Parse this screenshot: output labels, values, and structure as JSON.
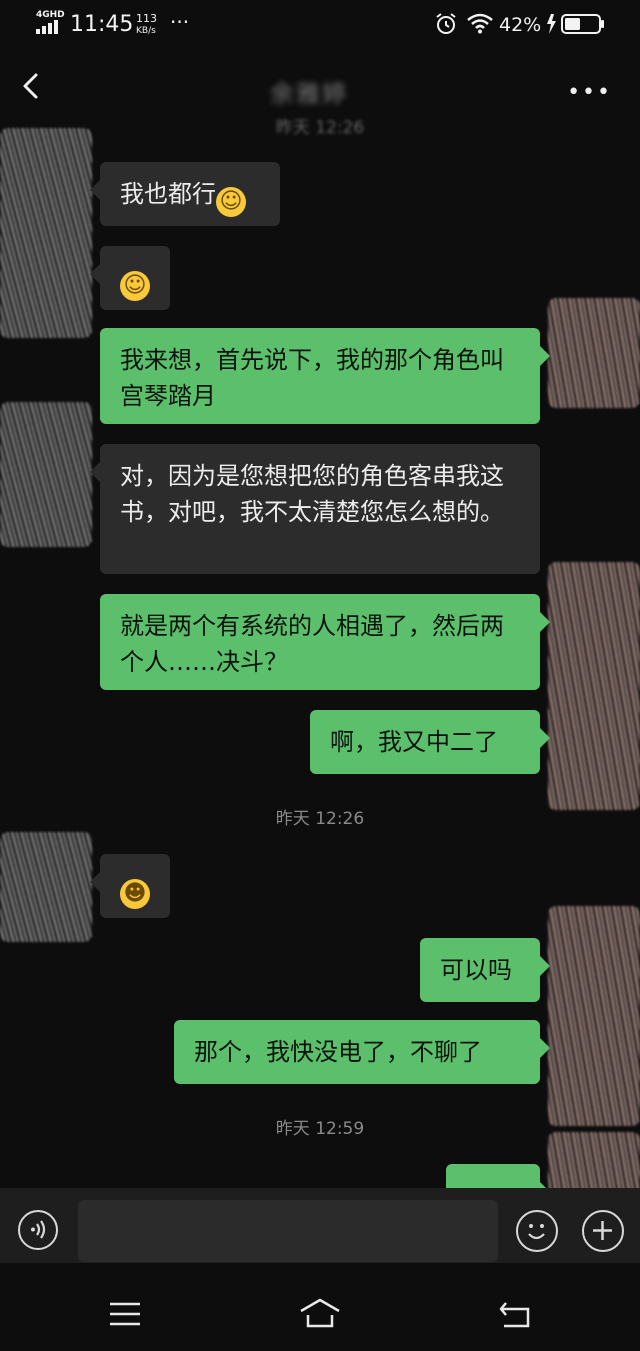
{
  "status_bar": {
    "network": "4GHD",
    "time": "11:45",
    "speed_value": "113",
    "speed_unit": "KB/s",
    "dots": "···",
    "battery": "42%"
  },
  "header": {
    "title": "余雅婷",
    "more": "•••"
  },
  "chat": {
    "top_time_partial": "昨天 12:26",
    "messages": [
      {
        "side": "left",
        "text": "我也都行",
        "emoji": "smile-emoji"
      },
      {
        "side": "left",
        "text": "",
        "emoji": "smile-emoji"
      },
      {
        "side": "right",
        "text": "我来想，首先说下，我的那个角色叫宫琴踏月"
      },
      {
        "side": "left",
        "text": "对，因为是您想把您的角色客串我这书，对吧，我不太清楚您怎么想的。"
      },
      {
        "side": "right",
        "text": "就是两个有系统的人相遇了，然后两个人……决斗？"
      },
      {
        "side": "right",
        "text": "啊，我又中二了"
      },
      {
        "side": "left",
        "text": "",
        "emoji": "grin-emoji"
      },
      {
        "side": "right",
        "text": "可以吗"
      },
      {
        "side": "right",
        "text": "那个，我快没电了，不聊了"
      },
      {
        "side": "right",
        "text": ""
      }
    ],
    "time_1": "昨天 12:26",
    "time_2": "昨天 12:59"
  },
  "input_bar": {
    "placeholder": ""
  },
  "colors": {
    "background": "#0d0d0d",
    "bubble_left": "#2c2c2c",
    "bubble_right": "#5cbf6c"
  }
}
